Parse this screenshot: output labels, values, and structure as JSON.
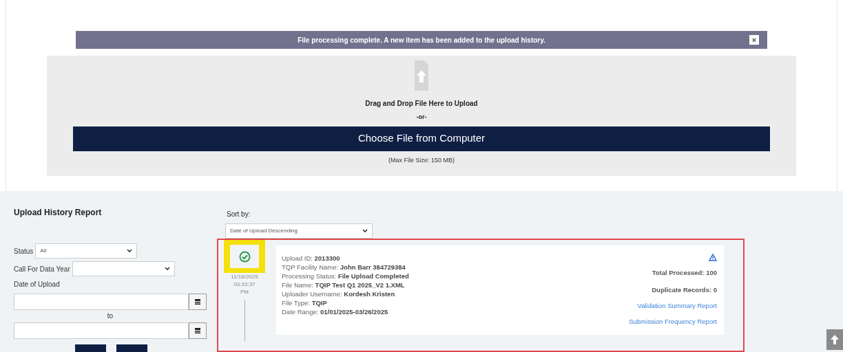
{
  "notification": {
    "message": "File processing complete. A new item has been added to the upload history.",
    "close": "×"
  },
  "upload": {
    "drop_text": "Drag and Drop File Here to Upload",
    "or_text": "-or-",
    "button": "Choose File from Computer",
    "max_size": "(Max File Size: 150 MB)"
  },
  "filters": {
    "title": "Upload History Report",
    "status_label": "Status",
    "status_value": "All",
    "year_label": "Call For Data Year",
    "date_label": "Date of Upload",
    "to_label": "to"
  },
  "sort": {
    "label": "Sort by:",
    "value": "Date of Upload Descending"
  },
  "history": [
    {
      "date": "11/18/2025",
      "time": "03:33:37",
      "ampm": "PM",
      "kind": "completed",
      "details": [
        "Upload ID: **2013300**",
        "TQP Facility Name: **John Barr 384729384**",
        "Processing Status: **File Upload Completed**",
        "File Name: **TQIP Test Q1 2025_V2 1.XML**",
        "Uploader Username: **Kordesh Kristen**",
        "File Type: **TQIP**",
        "Date Range: **01/01/2025-03/26/2025**"
      ],
      "stats": [
        "Total Processed: 100",
        "Duplicate Records: 0"
      ],
      "links": [
        "Validation Summary Report",
        "Submission Frequency Report"
      ]
    }
  ]
}
